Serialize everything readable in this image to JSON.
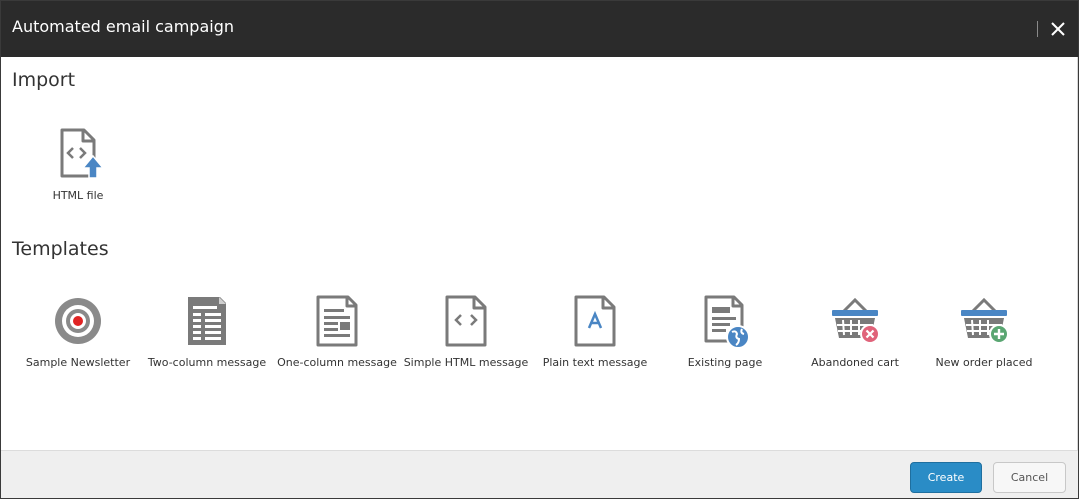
{
  "dialog": {
    "title": "Automated email campaign"
  },
  "import": {
    "heading": "Import",
    "items": [
      {
        "label": "HTML file",
        "icon": "html-file-upload-icon"
      }
    ]
  },
  "templates": {
    "heading": "Templates",
    "items": [
      {
        "label": "Sample Newsletter",
        "icon": "target-icon"
      },
      {
        "label": "Two-column message",
        "icon": "two-column-document-icon"
      },
      {
        "label": "One-column message",
        "icon": "one-column-document-icon"
      },
      {
        "label": "Simple HTML message",
        "icon": "html-document-icon"
      },
      {
        "label": "Plain text message",
        "icon": "text-document-icon"
      },
      {
        "label": "Existing page",
        "icon": "document-globe-icon"
      },
      {
        "label": "Abandoned cart",
        "icon": "basket-remove-icon"
      },
      {
        "label": "New order placed",
        "icon": "basket-add-icon"
      }
    ]
  },
  "footer": {
    "create_label": "Create",
    "cancel_label": "Cancel"
  },
  "colors": {
    "titlebar": "#2b2b2b",
    "primary_button": "#2a8cc6",
    "icon_gray": "#7a7a7a",
    "icon_blue": "#4a86c4",
    "icon_red": "#e0637a",
    "icon_green": "#5aa672",
    "target_red": "#e02424"
  }
}
